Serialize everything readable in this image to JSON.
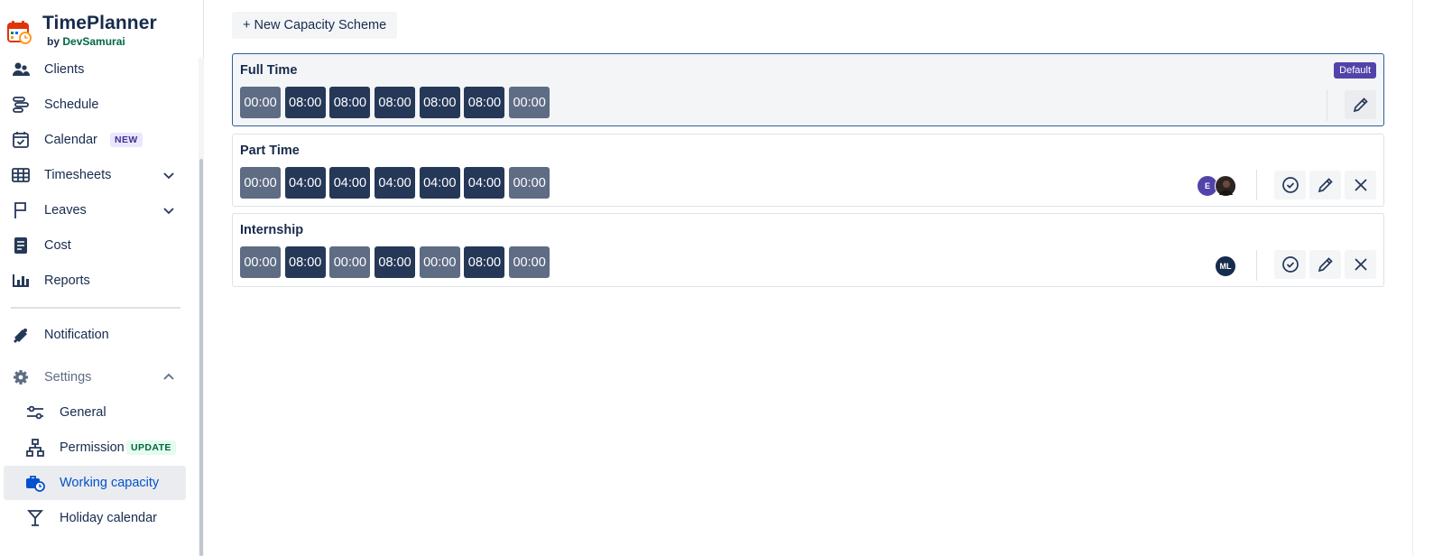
{
  "brand": {
    "title": "TimePlanner",
    "by": "by",
    "author": "DevSamurai"
  },
  "sidebar": {
    "items": [
      {
        "label": "Clients",
        "icon": "users-icon"
      },
      {
        "label": "Schedule",
        "icon": "schedule-icon"
      },
      {
        "label": "Calendar",
        "icon": "calendar-check-icon",
        "badge": "NEW"
      },
      {
        "label": "Timesheets",
        "icon": "table-icon",
        "expandable": true
      },
      {
        "label": "Leaves",
        "icon": "flag-icon",
        "expandable": true
      },
      {
        "label": "Cost",
        "icon": "receipt-icon"
      },
      {
        "label": "Reports",
        "icon": "bar-chart-icon"
      }
    ],
    "notification": {
      "label": "Notification",
      "icon": "bell-icon"
    },
    "settings": {
      "label": "Settings",
      "icon": "gear-icon",
      "expanded": true
    },
    "settings_items": [
      {
        "label": "General",
        "icon": "sliders-icon"
      },
      {
        "label": "Permission",
        "icon": "hierarchy-icon",
        "badge": "UPDATE"
      },
      {
        "label": "Working capacity",
        "icon": "briefcase-clock-icon",
        "active": true
      },
      {
        "label": "Holiday calendar",
        "icon": "cocktail-icon"
      }
    ]
  },
  "main": {
    "new_button_label": "+ New Capacity Scheme",
    "schemes": [
      {
        "name": "Full Time",
        "default_label": "Default",
        "days": [
          "00:00",
          "08:00",
          "08:00",
          "08:00",
          "08:00",
          "08:00",
          "00:00"
        ]
      },
      {
        "name": "Part Time",
        "days": [
          "00:00",
          "04:00",
          "04:00",
          "04:00",
          "04:00",
          "04:00",
          "00:00"
        ],
        "avatars": [
          "E",
          ""
        ]
      },
      {
        "name": "Internship",
        "days": [
          "00:00",
          "08:00",
          "00:00",
          "08:00",
          "00:00",
          "08:00",
          "00:00"
        ],
        "avatars": [
          "ML"
        ]
      }
    ]
  },
  "colors": {
    "work_day": "#253858",
    "off_day": "#5e6c84",
    "default_badge": "#5243aa",
    "active_link": "#0052cc"
  }
}
